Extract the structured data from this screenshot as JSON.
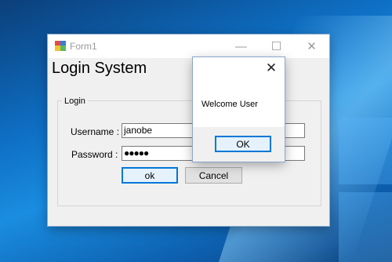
{
  "form": {
    "title": "Form1",
    "minimize_glyph": "—",
    "maximize_glyph": "☐",
    "close_glyph": "✕",
    "heading": "Login System",
    "group_label": "Login",
    "username_label": "Username :",
    "username_value": "janobe",
    "password_label": "Password :",
    "password_value": "●●●●●",
    "ok_label": "ok",
    "cancel_label": "Cancel"
  },
  "messagebox": {
    "close_glyph": "✕",
    "message": "Welcome User",
    "ok_label": "OK"
  },
  "colors": {
    "accent": "#0078d7",
    "desktop": "#0e6fc4"
  }
}
